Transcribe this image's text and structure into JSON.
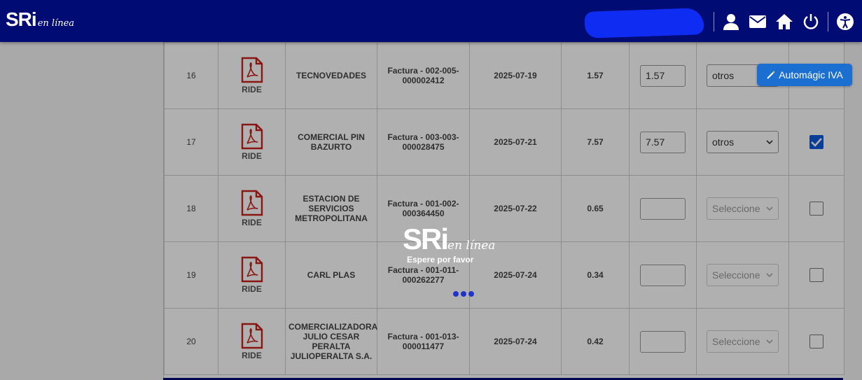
{
  "header": {
    "logo_main": "SRi",
    "logo_sub": "en línea",
    "icons": [
      "user-icon",
      "mail-icon",
      "home-icon",
      "power-icon",
      "accessibility-icon"
    ]
  },
  "auto_button": {
    "label": "Automágic IVA",
    "icon": "magic-wand-icon"
  },
  "loader": {
    "logo_main": "SRi",
    "logo_sub": "en línea",
    "message": "Espere por favor"
  },
  "table": {
    "ride_label": "RIDE",
    "rows": [
      {
        "num": "16",
        "provider": "TECNOVEDADES",
        "doc": "Factura - 002-005-000002412",
        "date": "2025-07-19",
        "amount": "1.57",
        "input": "1.57",
        "select": "otros",
        "checked": false
      },
      {
        "num": "17",
        "provider": "COMERCIAL PIN BAZURTO",
        "doc": "Factura - 003-003-000028475",
        "date": "2025-07-21",
        "amount": "7.57",
        "input": "7.57",
        "select": "otros",
        "checked": true
      },
      {
        "num": "18",
        "provider": "ESTACION DE SERVICIOS METROPOLITANA",
        "doc": "Factura - 001-002-000364450",
        "date": "2025-07-22",
        "amount": "0.65",
        "input": "",
        "select": "Seleccione",
        "checked": false
      },
      {
        "num": "19",
        "provider": "CARL PLAS",
        "doc": "Factura - 001-011-000262277",
        "date": "2025-07-24",
        "amount": "0.34",
        "input": "",
        "select": "Seleccione",
        "checked": false
      },
      {
        "num": "20",
        "provider": "COMERCIALIZADORA JULIO CESAR PERALTA JULIOPERALTA S.A.",
        "doc": "Factura - 001-013-000011477",
        "date": "2025-07-24",
        "amount": "0.42",
        "input": "",
        "select": "Seleccione",
        "checked": false
      }
    ]
  }
}
